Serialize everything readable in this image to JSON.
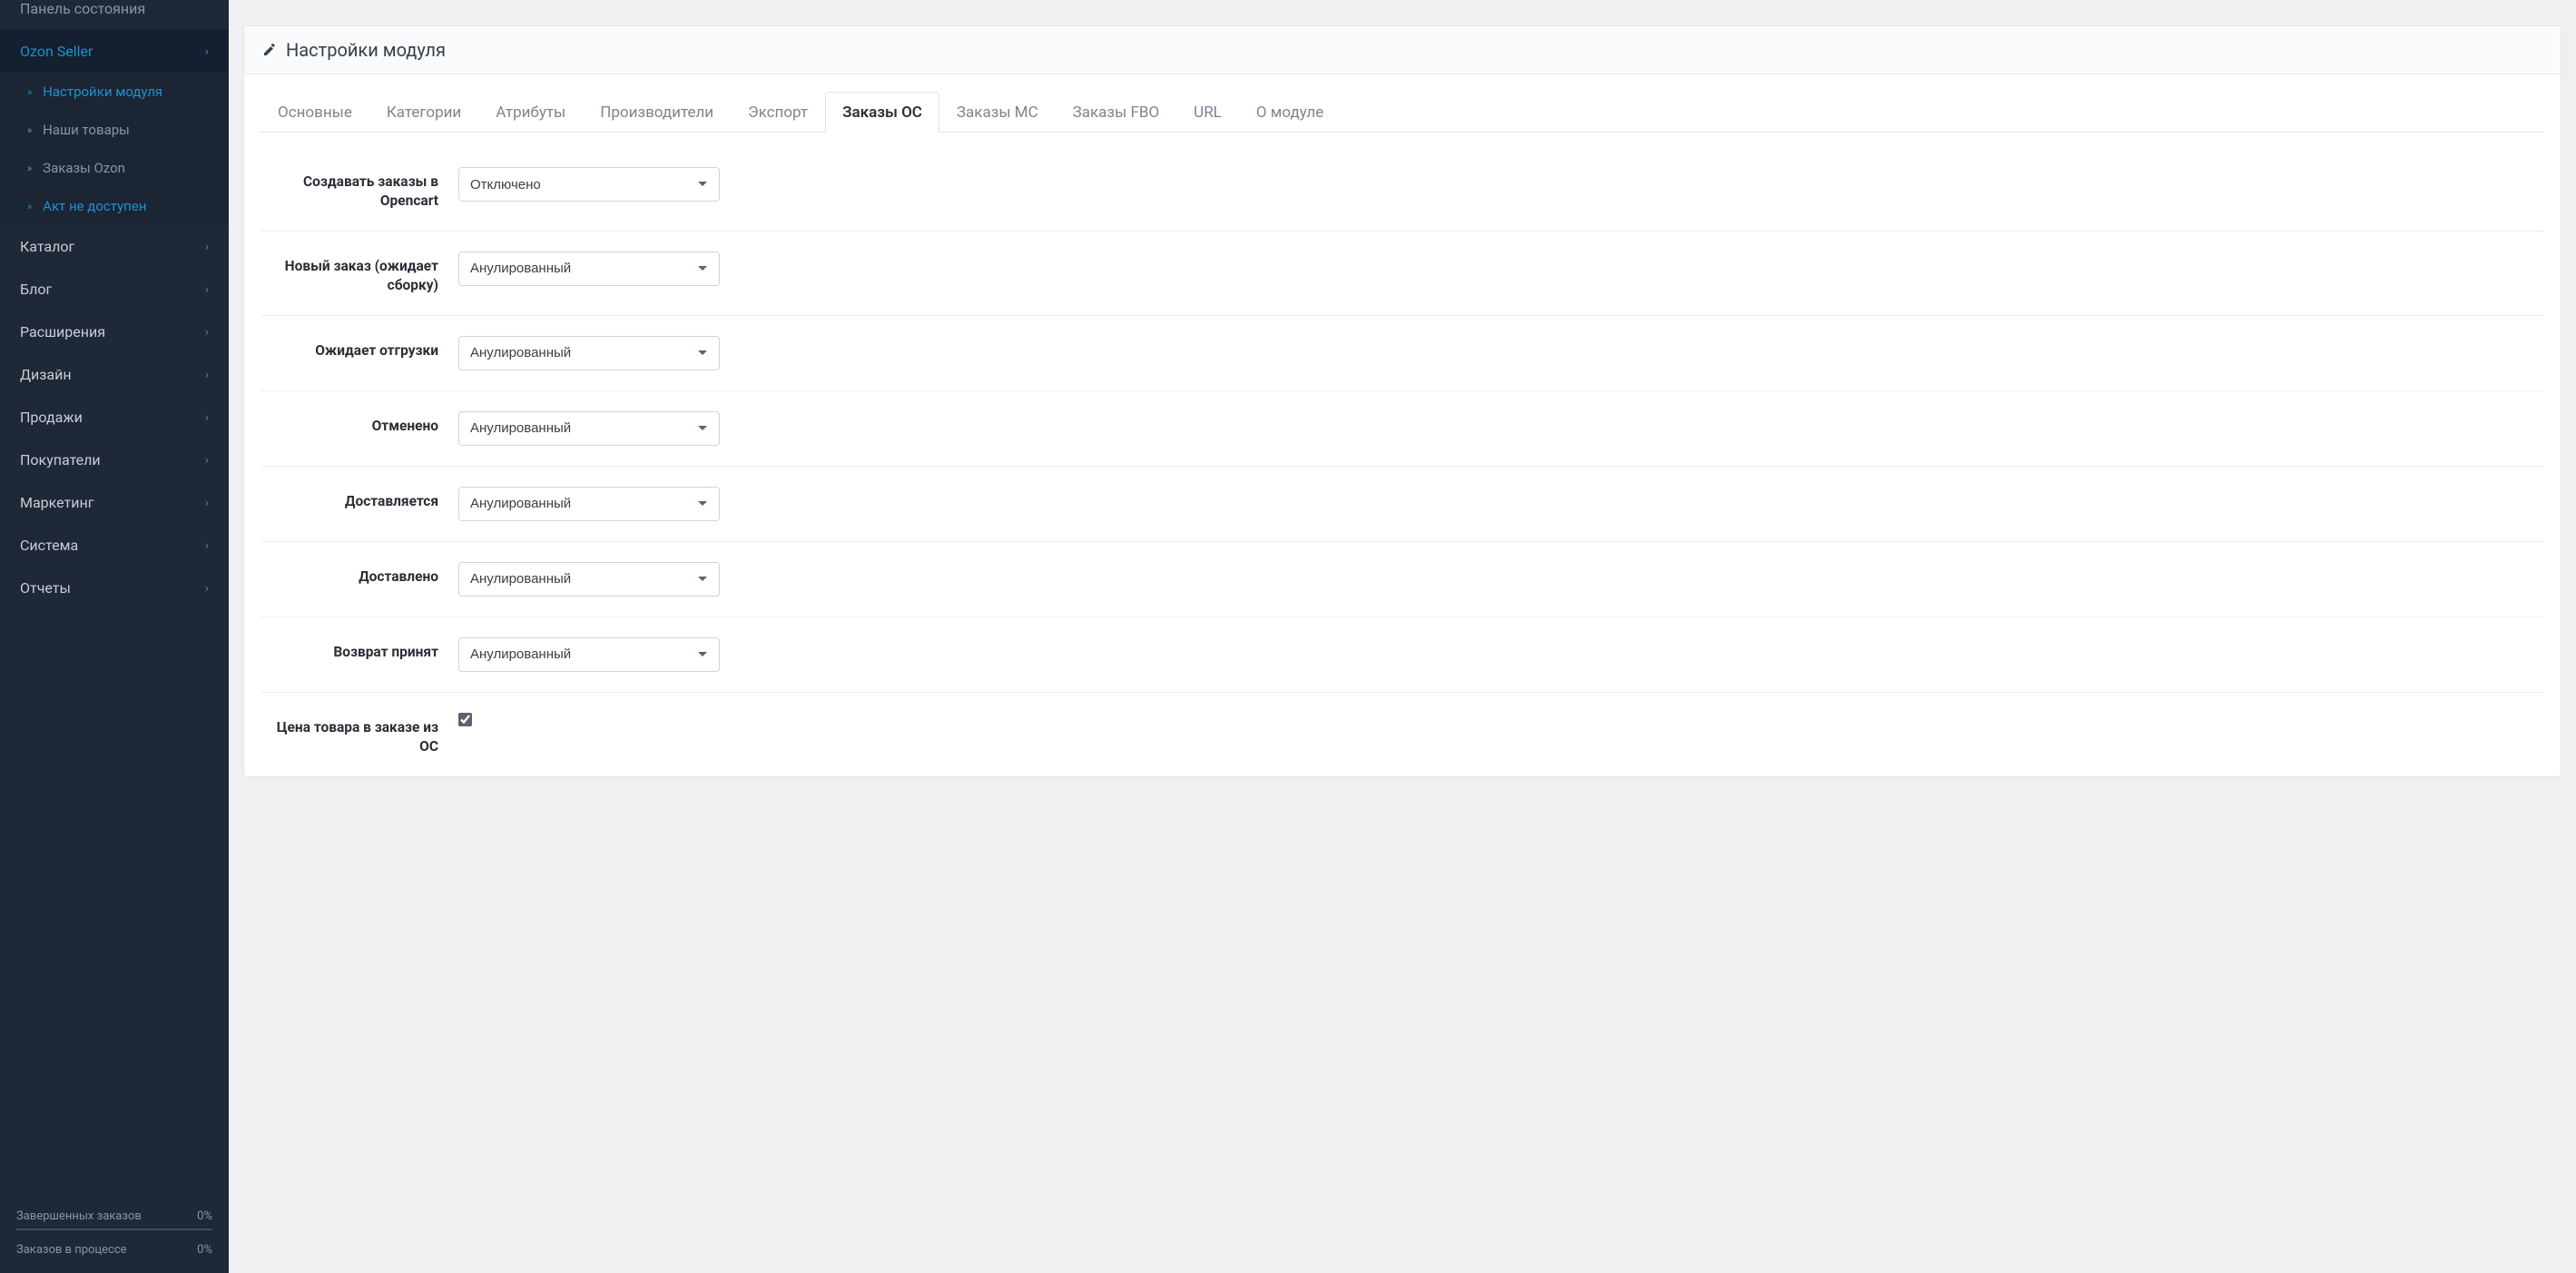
{
  "sidebar": {
    "panel_state": "Панель состояния",
    "ozon": "Ozon Seller",
    "ozon_sub": [
      {
        "label": "Настройки модуля",
        "highlight": true
      },
      {
        "label": "Наши товары",
        "highlight": false
      },
      {
        "label": "Заказы Ozon",
        "highlight": false
      },
      {
        "label": "Акт не доступен",
        "highlight": true
      }
    ],
    "menu": [
      "Каталог",
      "Блог",
      "Расширения",
      "Дизайн",
      "Продажи",
      "Покупатели",
      "Маркетинг",
      "Система",
      "Отчеты"
    ],
    "progress": [
      {
        "label": "Завершенных заказов",
        "value": "0%"
      },
      {
        "label": "Заказов в процессе",
        "value": "0%"
      }
    ]
  },
  "card": {
    "title": "Настройки модуля"
  },
  "tabs": [
    {
      "label": "Основные",
      "active": false
    },
    {
      "label": "Категории",
      "active": false
    },
    {
      "label": "Атрибуты",
      "active": false
    },
    {
      "label": "Производители",
      "active": false
    },
    {
      "label": "Экспорт",
      "active": false
    },
    {
      "label": "Заказы ОС",
      "active": true
    },
    {
      "label": "Заказы МС",
      "active": false
    },
    {
      "label": "Заказы FBO",
      "active": false
    },
    {
      "label": "URL",
      "active": false
    },
    {
      "label": "О модуле",
      "active": false
    }
  ],
  "form": {
    "rows": [
      {
        "label": "Создавать заказы в Opencart",
        "value": "Отключено"
      },
      {
        "label": "Новый заказ (ожидает сборку)",
        "value": "Анулированный"
      },
      {
        "label": "Ожидает отгрузки",
        "value": "Анулированный"
      },
      {
        "label": "Отменено",
        "value": "Анулированный"
      },
      {
        "label": "Доставляется",
        "value": "Анулированный"
      },
      {
        "label": "Доставлено",
        "value": "Анулированный"
      },
      {
        "label": "Возврат принят",
        "value": "Анулированный"
      }
    ],
    "price_row": {
      "label": "Цена товара в заказе из ОС",
      "checked": true
    }
  }
}
